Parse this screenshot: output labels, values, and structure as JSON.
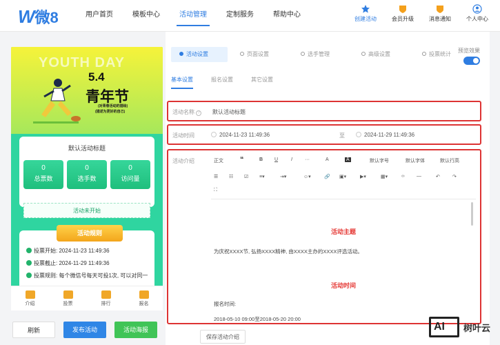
{
  "brand": {
    "logo_w": "W",
    "logo_text": "微8"
  },
  "nav": [
    "用户首页",
    "模板中心",
    "活动管理",
    "定制服务",
    "帮助中心"
  ],
  "right_nav": [
    "创建活动",
    "会员升级",
    "消息通知",
    "个人中心"
  ],
  "preview": {
    "hero_en": "YOUTH DAY",
    "hero_date": "5.4",
    "hero_title": "青年节",
    "hero_sub1": "(对青春活动的描绘)",
    "hero_sub2": "(描述为更好的自己)",
    "card_title": "默认活动标题",
    "stats": [
      {
        "num": "0",
        "label": "总票数"
      },
      {
        "num": "0",
        "label": "选手数"
      },
      {
        "num": "0",
        "label": "访问量"
      }
    ],
    "status": "活动未开始",
    "rules_title": "活动规则",
    "rules": [
      "投票开始: 2024-11-23 11:49:36",
      "投票截止: 2024-11-29 11:49:36",
      "投票规则: 每个微信号每天可投1次, 可以对同一"
    ],
    "tabs": [
      "介绍",
      "投票",
      "排行",
      "报名"
    ]
  },
  "buttons": {
    "refresh": "刷新",
    "publish": "发布活动",
    "poster": "活动海报"
  },
  "steps": [
    "活动设置",
    "页面设置",
    "选手管理",
    "高级设置",
    "投票统计"
  ],
  "preview_toggle": "预览效果",
  "subtabs": [
    "基本设置",
    "报名设置",
    "其它设置"
  ],
  "form": {
    "name_label": "活动名称",
    "name_value": "默认活动标题",
    "time_label": "活动时间",
    "start_time": "2024-11-23 11:49:36",
    "to_label": "至",
    "end_time": "2024-11-29 11:49:36",
    "intro_label": "活动介绍"
  },
  "toolbar_row1": [
    "正文",
    "❝",
    "B",
    "U",
    "I",
    "···",
    "A",
    "A",
    "默认字号",
    "默认字体",
    "默认行高"
  ],
  "editor": {
    "heading1": "活动主题",
    "para1": "为庆祝XXXX节, 弘扬XXXX精神, 由XXXX主办的XXXX评选活动。",
    "heading2": "活动时间",
    "para2": "报名时间:",
    "para3": "2018-05-10 09:00至2018-05-20 20:00"
  },
  "save_button": "保存活动介绍",
  "watermark": {
    "box": "AI",
    "text": "树叶云"
  }
}
